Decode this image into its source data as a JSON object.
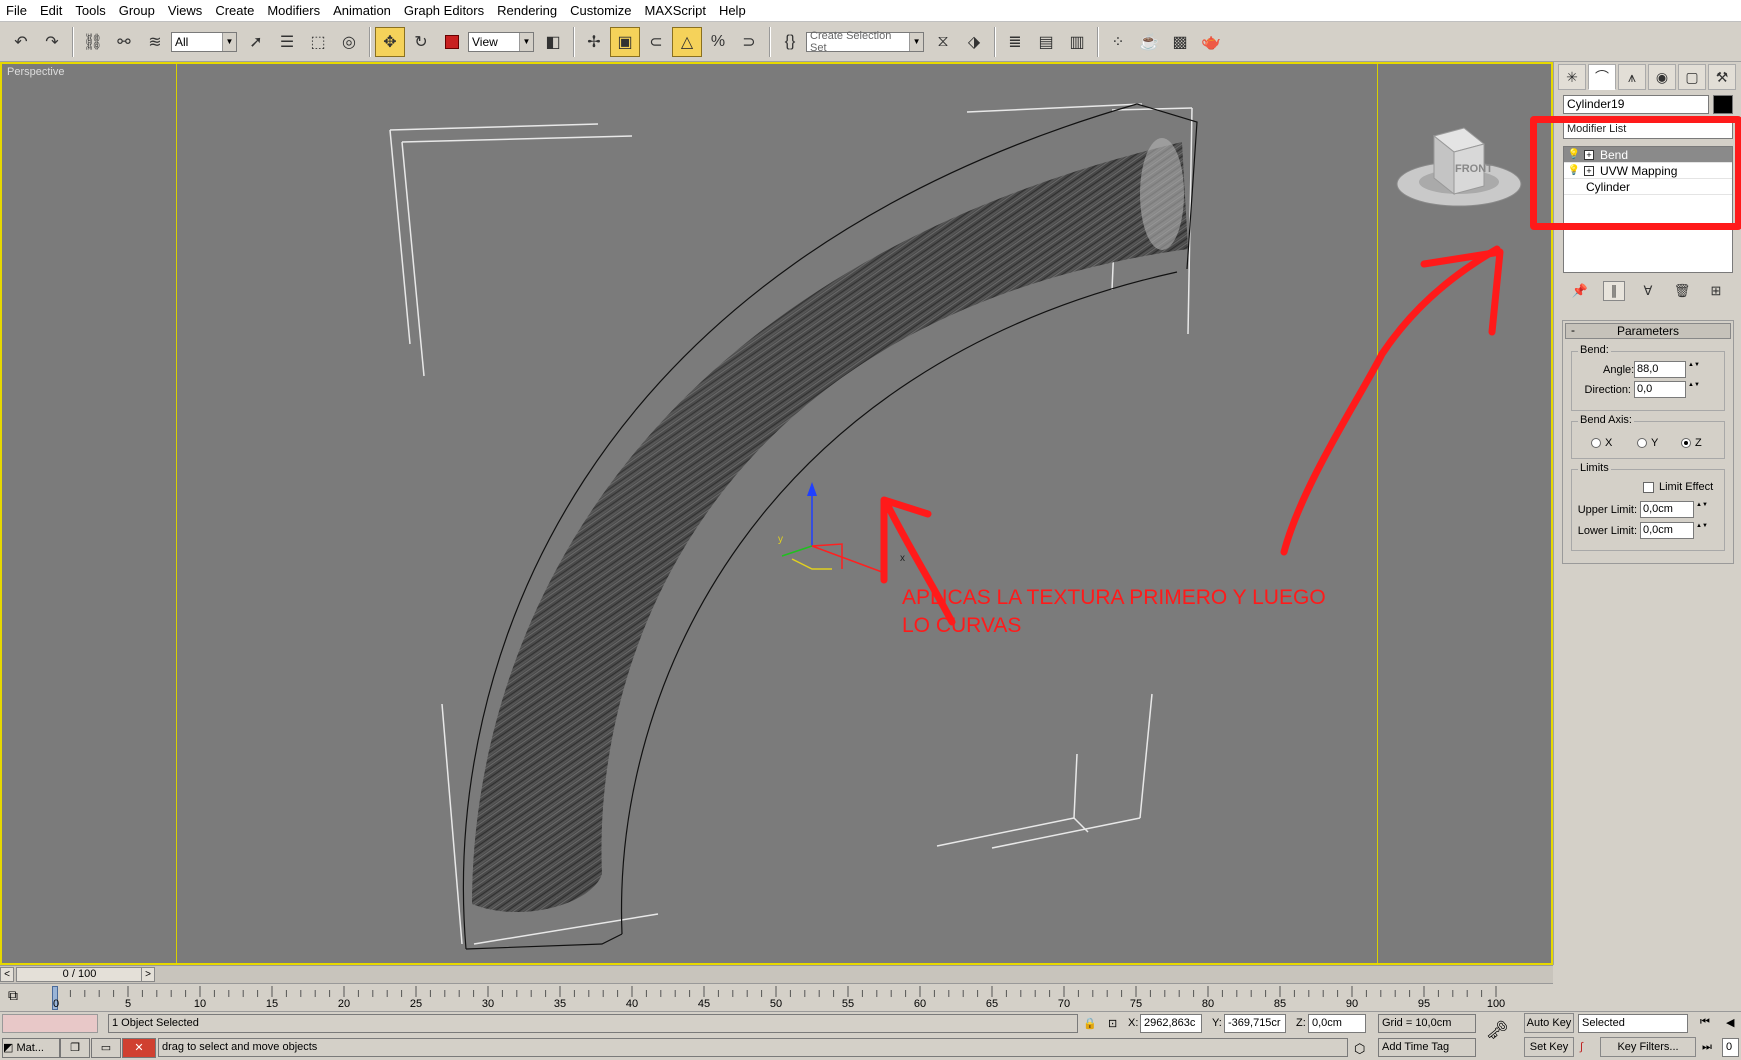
{
  "menu": [
    "File",
    "Edit",
    "Tools",
    "Group",
    "Views",
    "Create",
    "Modifiers",
    "Animation",
    "Graph Editors",
    "Rendering",
    "Customize",
    "MAXScript",
    "Help"
  ],
  "toolbar": {
    "filter_value": "All",
    "coord_value": "View",
    "selection_set_placeholder": "Create Selection Set"
  },
  "viewport": {
    "label": "Perspective",
    "viewcube_label": "FRONT",
    "annotation_line1": "APLICAS LA TEXTURA PRIMERO Y LUEGO",
    "annotation_line2": "LO CURVAS",
    "annotation_color": "#ff1a1a",
    "gizmo_labels": {
      "y": "y",
      "x": "x"
    }
  },
  "command_panel": {
    "object_name": "Cylinder19",
    "object_color": "#000000",
    "modifier_list": "Modifier List",
    "stack": [
      {
        "label": "Bend",
        "selected": true,
        "expandable": true
      },
      {
        "label": "UVW Mapping",
        "selected": false,
        "expandable": true
      },
      {
        "label": "Cylinder",
        "selected": false,
        "expandable": false
      }
    ],
    "parameters": {
      "title": "Parameters",
      "bend_group": "Bend:",
      "angle_label": "Angle:",
      "angle_value": "88,0",
      "direction_label": "Direction:",
      "direction_value": "0,0",
      "bend_axis_group": "Bend Axis:",
      "axis_x": "X",
      "axis_y": "Y",
      "axis_z": "Z",
      "selected_axis": "Z",
      "limits_group": "Limits",
      "limit_effect_label": "Limit Effect",
      "limit_effect_checked": false,
      "upper_limit_label": "Upper Limit:",
      "upper_limit_value": "0,0cm",
      "lower_limit_label": "Lower Limit:",
      "lower_limit_value": "0,0cm"
    }
  },
  "timeline": {
    "slider_text": "0 / 100",
    "tick_labels": [
      "0",
      "5",
      "10",
      "15",
      "20",
      "25",
      "30",
      "35",
      "40",
      "45",
      "50",
      "55",
      "60",
      "65",
      "70",
      "75",
      "80",
      "85",
      "90",
      "95",
      "100"
    ]
  },
  "status": {
    "selection_info": "1 Object Selected",
    "prompt": "drag to select and move objects",
    "x_label": "X:",
    "x_value": "2962,863c",
    "y_label": "Y:",
    "y_value": "-369,715cr",
    "z_label": "Z:",
    "z_value": "0,0cm",
    "grid": "Grid = 10,0cm",
    "add_time_tag": "Add Time Tag",
    "auto_key": "Auto Key",
    "set_key": "Set Key",
    "key_mode": "Selected",
    "key_filters": "Key Filters...",
    "frame_field": "0",
    "taskbar_app": "Mat..."
  }
}
